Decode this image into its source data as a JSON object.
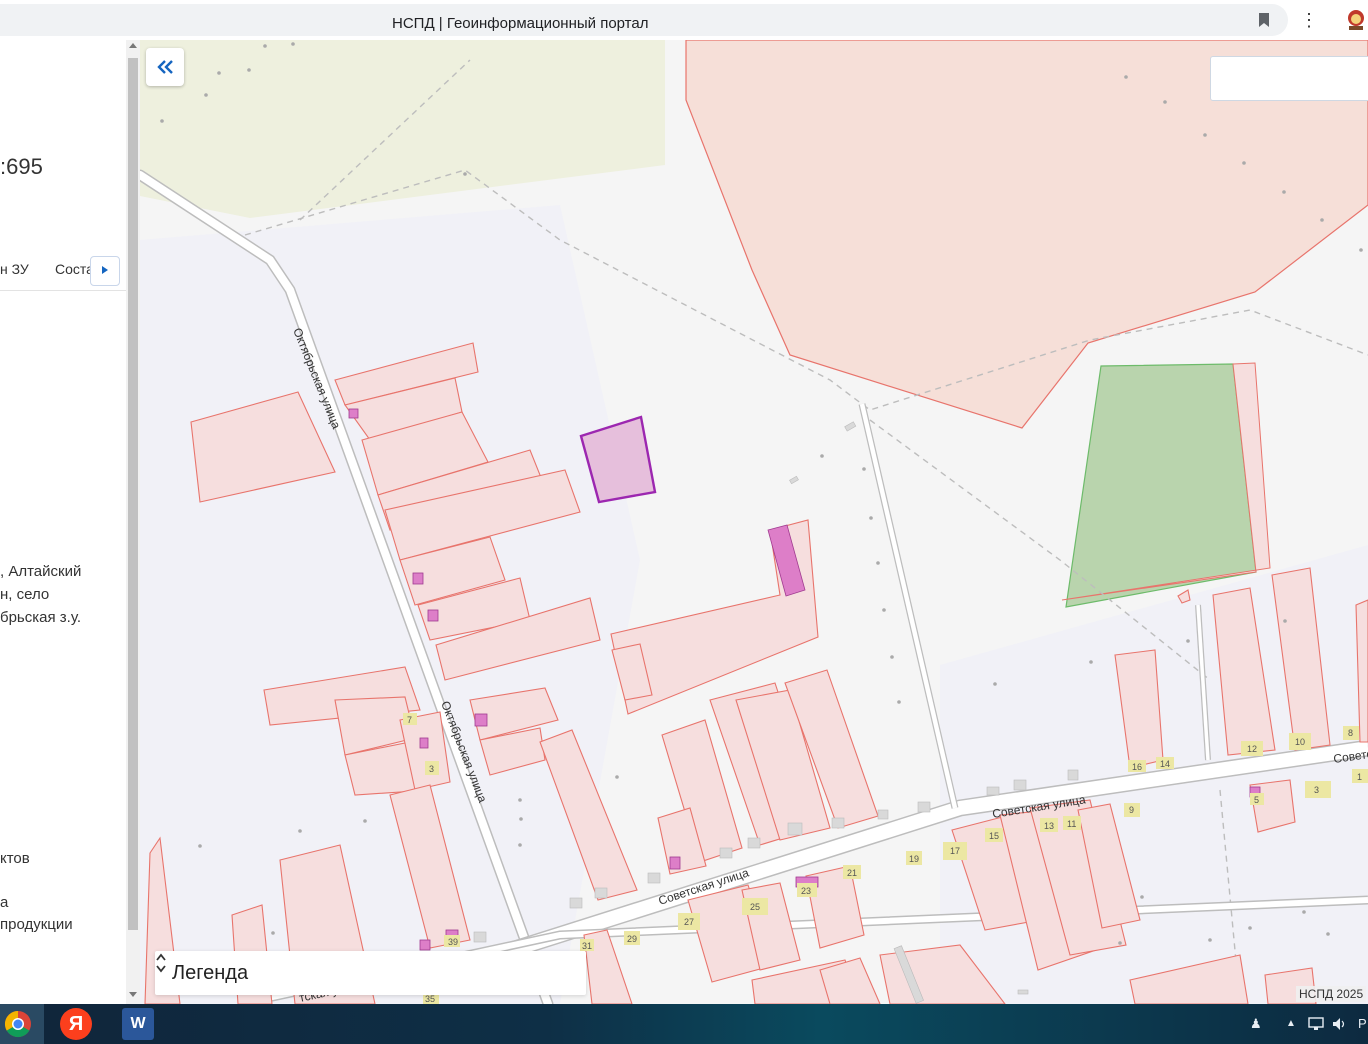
{
  "browser": {
    "tab_title": "НСПД | Геоинформационный портал",
    "menu_icon": "kebab-menu-icon",
    "bookmark_icon": "bookmark-icon",
    "extension_icon": "extension-icon"
  },
  "panel": {
    "cadastral_fragment": ":695",
    "tabs": [
      "н ЗУ",
      "Соста"
    ],
    "tab_scroll_icon": "chevron-right-icon",
    "address_lines": [
      ", Алтайский",
      "н, село",
      "брьская з.у."
    ],
    "use_lines": [
      "ктов",
      "",
      "а",
      "продукции"
    ]
  },
  "map": {
    "collapse_icon": "double-chevron-left-icon",
    "search_placeholder": "",
    "legend_label": "Легенда",
    "legend_toggle_icon": "expand-collapse-icon",
    "attribution": "НСПД 2025",
    "streets": {
      "oktyabrskaya": "Октябрьская улица",
      "sovetskaya": "Советская улица",
      "sovetskaya_edge": "Совето",
      "bottom_street": "тская ул"
    },
    "house_numbers": [
      "7",
      "3",
      "35",
      "31",
      "29",
      "27",
      "25",
      "23",
      "21",
      "19",
      "17",
      "15",
      "13",
      "11",
      "9",
      "16",
      "14",
      "12",
      "10",
      "8",
      "5",
      "3",
      "1",
      "39"
    ],
    "colors": {
      "parcel_fill": "#f6dede",
      "parcel_stroke": "#e8746c",
      "selected_fill": "#e6bfdc",
      "selected_stroke": "#9c27b0",
      "green_zone": "#b9d4ad",
      "field_zone": "#eef0de",
      "large_zone": "#f6dfd8",
      "building": "#dd7ec8",
      "house_label": "#ece7a3"
    }
  },
  "taskbar": {
    "apps": [
      "chrome-icon",
      "yandex-icon",
      "word-icon"
    ],
    "yandex_letter": "Я",
    "word_letter": "W",
    "tray_label": "Р"
  }
}
